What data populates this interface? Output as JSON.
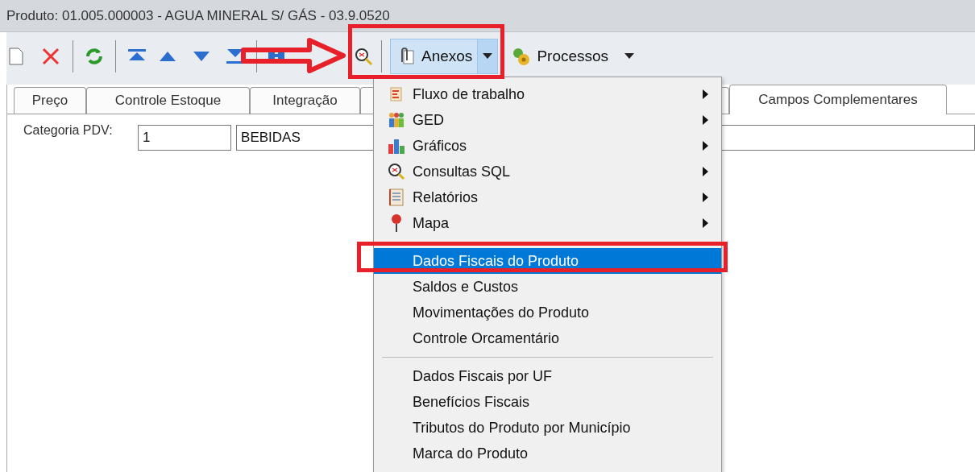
{
  "window": {
    "title": "Produto: 01.005.000003 - AGUA MINERAL S/ GÁS - 03.9.0520"
  },
  "toolbar": {
    "menus": [
      {
        "label": "Anexos",
        "kind": "split",
        "open": true
      },
      {
        "label": "Processos",
        "kind": "dropdown",
        "open": false
      }
    ]
  },
  "tabs": [
    {
      "label": "Preço",
      "selected": false
    },
    {
      "label": "Controle Estoque",
      "selected": false
    },
    {
      "label": "Integração",
      "selected": false
    },
    {
      "selected": false
    },
    {
      "label": "Campos Complementares",
      "selected": true
    }
  ],
  "form": {
    "label": "Categoria PDV:",
    "code": "1",
    "description": "BEBIDAS"
  },
  "dropdown_menu": {
    "items": [
      {
        "kind": "submenu",
        "label": "Fluxo de trabalho",
        "selected": false
      },
      {
        "kind": "submenu",
        "label": "GED",
        "selected": false
      },
      {
        "kind": "submenu",
        "label": "Gráficos",
        "selected": false
      },
      {
        "kind": "submenu",
        "label": "Consultas SQL",
        "selected": false
      },
      {
        "kind": "submenu",
        "label": "Relatórios",
        "selected": false
      },
      {
        "kind": "submenu",
        "label": "Mapa",
        "selected": false
      },
      {
        "kind": "separator"
      },
      {
        "kind": "item",
        "label": "Dados Fiscais do Produto",
        "selected": true
      },
      {
        "kind": "item",
        "label": "Saldos e Custos",
        "selected": false
      },
      {
        "kind": "item",
        "label": "Movimentações do Produto",
        "selected": false
      },
      {
        "kind": "item",
        "label": "Controle Orcamentário",
        "selected": false
      },
      {
        "kind": "separator"
      },
      {
        "kind": "item",
        "label": "Dados Fiscais por UF",
        "selected": false
      },
      {
        "kind": "item",
        "label": "Benefícios Fiscais",
        "selected": false
      },
      {
        "kind": "item",
        "label": "Tributos do Produto por Município",
        "selected": false
      },
      {
        "kind": "item",
        "label": "Marca do Produto",
        "selected": false
      }
    ]
  }
}
